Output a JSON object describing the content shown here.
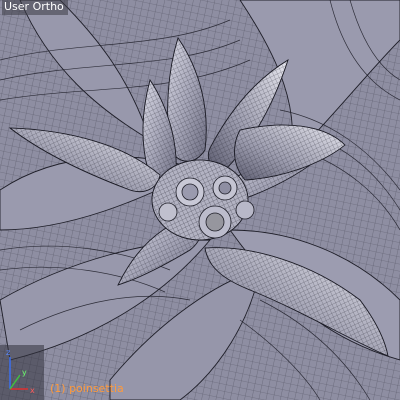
{
  "viewport": {
    "view_name": "User Ortho",
    "object_info": "(1) poinsettia",
    "colors": {
      "background": "#8c8ca0",
      "wire": "#1e1e28",
      "object_label": "#ff9a3c",
      "axis_x": "#e03030",
      "axis_y": "#40c040",
      "axis_z": "#3a6ff0"
    },
    "axis_gizmo": {
      "axes": [
        "x",
        "y",
        "z"
      ]
    }
  }
}
